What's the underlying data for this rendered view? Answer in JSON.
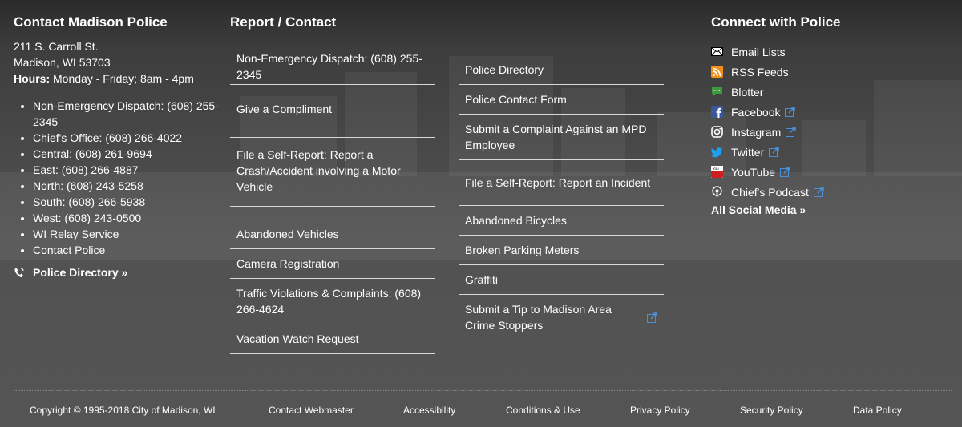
{
  "contact": {
    "heading": "Contact Madison Police",
    "address_line1": "211 S. Carroll St.",
    "address_line2": "Madison, WI 53703",
    "hours_label": "Hours:",
    "hours_value": "Monday - Friday; 8am - 4pm",
    "phones": [
      "Non-Emergency Dispatch: (608) 255-2345",
      "Chief's Office: (608) 266-4022",
      "Central: (608) 261-9694",
      "East: (608) 266-4887",
      "North: (608) 243-5258",
      "South: (608) 266-5938",
      "West: (608) 243-0500",
      "WI Relay Service",
      "Contact Police"
    ],
    "directory_link": "Police Directory »"
  },
  "report": {
    "heading": "Report / Contact",
    "column_a": [
      "Non-Emergency Dispatch: (608) 255-2345",
      "Give a Compliment",
      "File a Self-Report: Report a Crash/Accident involving a Motor Vehicle",
      "Abandoned Vehicles",
      "Camera Registration",
      "Traffic Violations & Complaints: (608) 266-4624",
      "Vacation Watch Request"
    ],
    "column_b": [
      "Police Directory",
      "Police Contact Form",
      "Submit a Complaint Against an MPD Employee",
      "File a Self-Report: Report an Incident",
      "Abandoned Bicycles",
      "Broken Parking Meters",
      "Graffiti",
      "Submit a Tip to Madison Area Crime Stoppers"
    ]
  },
  "connect": {
    "heading": "Connect with Police",
    "items": [
      {
        "label": "Email Lists",
        "icon": "envelope-icon"
      },
      {
        "label": "RSS Feeds",
        "icon": "rss-icon"
      },
      {
        "label": "Blotter",
        "icon": "chat-bubble-icon"
      },
      {
        "label": "Facebook",
        "icon": "facebook-icon"
      },
      {
        "label": "Instagram",
        "icon": "instagram-icon"
      },
      {
        "label": "Twitter",
        "icon": "twitter-icon"
      },
      {
        "label": "YouTube",
        "icon": "youtube-icon"
      },
      {
        "label": "Chief's Podcast",
        "icon": "podcast-icon"
      }
    ],
    "all_social": "All Social Media »"
  },
  "footer": {
    "copyright": "Copyright © 1995-2018 City of Madison, WI",
    "links": [
      "Contact Webmaster",
      "Accessibility",
      "Conditions & Use",
      "Privacy Policy",
      "Security Policy",
      "Data Policy"
    ]
  },
  "colors": {
    "background": "#4a4a4a",
    "text": "#ffffff",
    "rule": "#d8d8d8",
    "external_link": "#4a90d9"
  }
}
